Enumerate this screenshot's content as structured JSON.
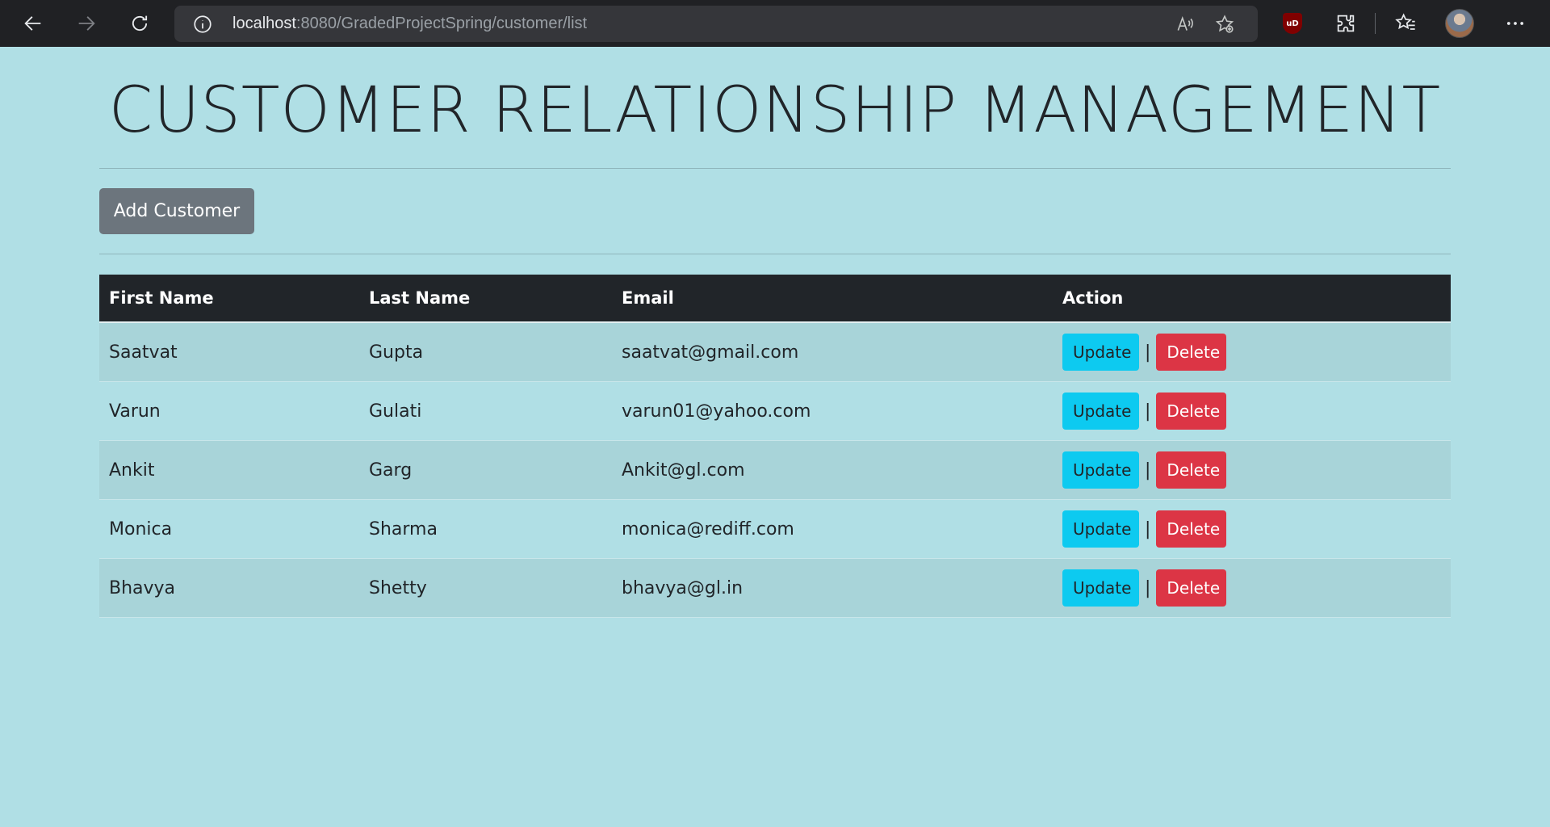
{
  "browser": {
    "url_host": "localhost",
    "url_path": ":8080/GradedProjectSpring/customer/list",
    "icons": [
      "back-icon",
      "forward-icon",
      "refresh-icon",
      "info-icon",
      "read-aloud-icon",
      "add-favorite-icon",
      "ublock-icon",
      "extensions-icon",
      "favorites-icon",
      "profile-avatar",
      "more-icon"
    ],
    "ublock_label": "uD"
  },
  "page": {
    "title": "CUSTOMER RELATIONSHIP MANAGEMENT",
    "add_button": "Add Customer"
  },
  "table": {
    "headers": {
      "first_name": "First Name",
      "last_name": "Last Name",
      "email": "Email",
      "action": "Action"
    },
    "update_label": "Update",
    "delete_label": "Delete",
    "separator": "|",
    "rows": [
      {
        "first_name": "Saatvat",
        "last_name": "Gupta",
        "email": "saatvat@gmail.com"
      },
      {
        "first_name": "Varun",
        "last_name": "Gulati",
        "email": "varun01@yahoo.com"
      },
      {
        "first_name": "Ankit",
        "last_name": "Garg",
        "email": "Ankit@gl.com"
      },
      {
        "first_name": "Monica",
        "last_name": "Sharma",
        "email": "monica@rediff.com"
      },
      {
        "first_name": "Bhavya",
        "last_name": "Shetty",
        "email": "bhavya@gl.in"
      }
    ]
  },
  "colors": {
    "page_bg": "#b0dfe5",
    "header_bg": "#212529",
    "update_btn": "#0dcaf0",
    "delete_btn": "#dc3545",
    "add_btn": "#6c757d"
  }
}
